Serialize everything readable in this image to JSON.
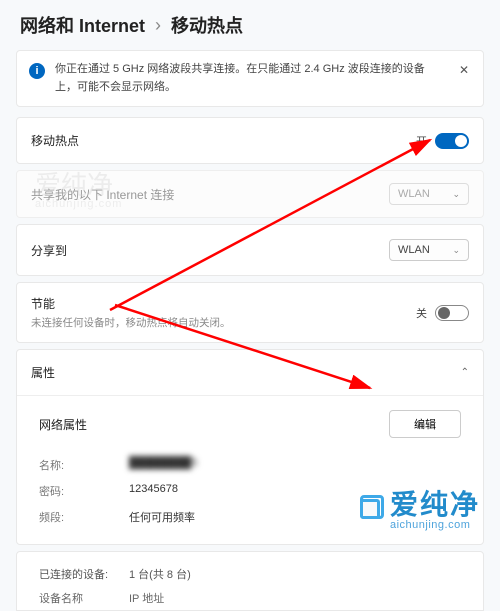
{
  "breadcrumb": {
    "parent": "网络和 Internet",
    "sep": "›",
    "current": "移动热点"
  },
  "banner": {
    "icon": "i",
    "text": "你正在通过 5 GHz 网络波段共享连接。在只能通过 2.4 GHz 波段连接的设备上，可能不会显示网络。",
    "close": "✕"
  },
  "hotspot": {
    "label": "移动热点",
    "state_label": "开"
  },
  "share_from": {
    "label": "共享我的以下 Internet 连接",
    "value": "WLAN",
    "chev": "⌄"
  },
  "share_to": {
    "label": "分享到",
    "value": "WLAN",
    "chev": "⌄"
  },
  "power": {
    "label": "节能",
    "sub": "未连接任何设备时，移动热点将自动关闭。",
    "state_label": "关"
  },
  "props": {
    "header": "属性",
    "chev": "⌃",
    "title": "网络属性",
    "edit": "编辑",
    "name_k": "名称:",
    "name_v": "████████5",
    "pwd_k": "密码:",
    "pwd_v": "12345678",
    "band_k": "频段:",
    "band_v": "任何可用频率"
  },
  "devices": {
    "conn_k": "已连接的设备:",
    "conn_v": "1 台(共 8 台)",
    "col1": "设备名称",
    "col2": "IP 地址"
  },
  "watermark": {
    "text": "爱纯净",
    "sub": "aichunjing.com",
    "big": "爱纯净",
    "url": "aichunjing.com"
  }
}
